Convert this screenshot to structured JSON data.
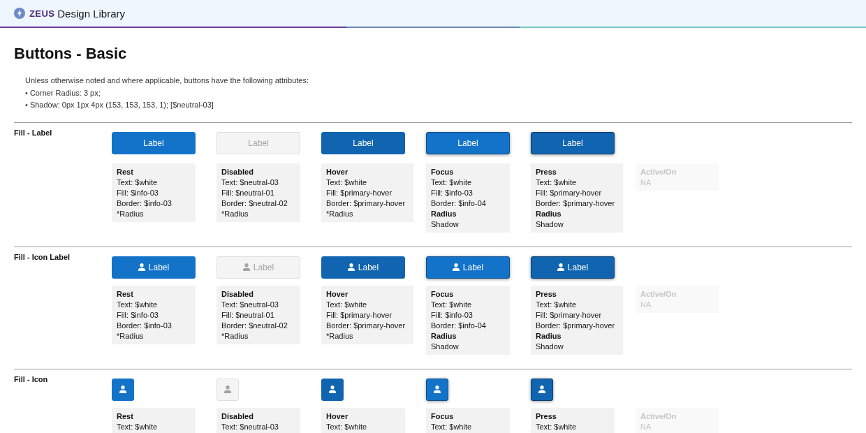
{
  "header": {
    "brand": "ZEUS",
    "title": "Design Library"
  },
  "page_title": "Buttons - Basic",
  "intro": {
    "text": "Unless otherwise noted and where applicable, buttons have the following attributes:",
    "bullets": [
      "• Corner Radius: 3 px;",
      "• Shadow: 0px 1px 4px (153, 153, 153, 1); [$neutral-03]"
    ]
  },
  "sections": [
    {
      "title": "Fill - Label",
      "kind": "label",
      "states": [
        {
          "kind": "rest",
          "button_label": "Label",
          "spec": {
            "title": "Rest",
            "lines": [
              {
                "text": "Text: $white",
                "bold": false
              },
              {
                "text": "Fill: $info-03",
                "bold": false
              },
              {
                "text": "Border: $info-03",
                "bold": false
              },
              {
                "text": "*Radius",
                "bold": false
              }
            ]
          }
        },
        {
          "kind": "disabled",
          "button_label": "Label",
          "spec": {
            "title": "Disabled",
            "lines": [
              {
                "text": "Text: $neutral-03",
                "bold": false
              },
              {
                "text": "Fill: $neutral-01",
                "bold": false
              },
              {
                "text": "Border: $neutral-02",
                "bold": false
              },
              {
                "text": "*Radius",
                "bold": false
              }
            ]
          }
        },
        {
          "kind": "hover",
          "button_label": "Label",
          "spec": {
            "title": "Hover",
            "lines": [
              {
                "text": "Text: $white",
                "bold": false
              },
              {
                "text": "Fill: $primary-hover",
                "bold": false
              },
              {
                "text": "Border: $primary-hover",
                "bold": false
              },
              {
                "text": "*Radius",
                "bold": false
              }
            ]
          }
        },
        {
          "kind": "focus",
          "button_label": "Label",
          "spec": {
            "title": "Focus",
            "lines": [
              {
                "text": "Text: $white",
                "bold": false
              },
              {
                "text": "Fill: $info-03",
                "bold": false
              },
              {
                "text": "Border: $info-04",
                "bold": false
              },
              {
                "text": "Radius",
                "bold": true
              },
              {
                "text": "Shadow",
                "bold": false
              }
            ]
          }
        },
        {
          "kind": "press",
          "button_label": "Label",
          "spec": {
            "title": "Press",
            "lines": [
              {
                "text": "Text: $white",
                "bold": false
              },
              {
                "text": "Fill: $primary-hover",
                "bold": false
              },
              {
                "text": "Border: $primary-hover",
                "bold": false
              },
              {
                "text": "Radius",
                "bold": true
              },
              {
                "text": "Shadow",
                "bold": false
              }
            ]
          }
        },
        {
          "kind": "na",
          "spec": {
            "title": "Active/On",
            "lines": [
              {
                "text": "NA",
                "bold": false
              }
            ]
          }
        }
      ]
    },
    {
      "title": "Fill - Icon Label",
      "kind": "icon-label",
      "states": [
        {
          "kind": "rest",
          "button_label": "Label",
          "spec": {
            "title": "Rest",
            "lines": [
              {
                "text": "Text: $white",
                "bold": false
              },
              {
                "text": "Fill: $info-03",
                "bold": false
              },
              {
                "text": "Border: $info-03",
                "bold": false
              },
              {
                "text": "*Radius",
                "bold": false
              }
            ]
          }
        },
        {
          "kind": "disabled",
          "button_label": "Label",
          "spec": {
            "title": "Disabled",
            "lines": [
              {
                "text": "Text: $neutral-03",
                "bold": false
              },
              {
                "text": "Fill: $neutral-01",
                "bold": false
              },
              {
                "text": "Border: $neutral-02",
                "bold": false
              },
              {
                "text": "*Radius",
                "bold": false
              }
            ]
          }
        },
        {
          "kind": "hover",
          "button_label": "Label",
          "spec": {
            "title": "Hover",
            "lines": [
              {
                "text": "Text: $white",
                "bold": false
              },
              {
                "text": "Fill: $primary-hover",
                "bold": false
              },
              {
                "text": "Border: $primary-hover",
                "bold": false
              },
              {
                "text": "*Radius",
                "bold": false
              }
            ]
          }
        },
        {
          "kind": "focus",
          "button_label": "Label",
          "spec": {
            "title": "Focus",
            "lines": [
              {
                "text": "Text: $white",
                "bold": false
              },
              {
                "text": "Fill: $info-03",
                "bold": false
              },
              {
                "text": "Border: $info-04",
                "bold": false
              },
              {
                "text": "Radius",
                "bold": true
              },
              {
                "text": "Shadow",
                "bold": false
              }
            ]
          }
        },
        {
          "kind": "press",
          "button_label": "Label",
          "spec": {
            "title": "Press",
            "lines": [
              {
                "text": "Text: $white",
                "bold": false
              },
              {
                "text": "Fill: $primary-hover",
                "bold": false
              },
              {
                "text": "Border: $primary-hover",
                "bold": false
              },
              {
                "text": "Radius",
                "bold": true
              },
              {
                "text": "Shadow",
                "bold": false
              }
            ]
          }
        },
        {
          "kind": "na",
          "spec": {
            "title": "Active/On",
            "lines": [
              {
                "text": "NA",
                "bold": false
              }
            ]
          }
        }
      ]
    },
    {
      "title": "Fill - Icon",
      "kind": "icon",
      "states": [
        {
          "kind": "rest",
          "spec": {
            "title": "Rest",
            "lines": [
              {
                "text": "Text: $white",
                "bold": false
              }
            ]
          }
        },
        {
          "kind": "disabled",
          "spec": {
            "title": "Disabled",
            "lines": [
              {
                "text": "Text: $neutral-03",
                "bold": false
              }
            ]
          }
        },
        {
          "kind": "hover",
          "spec": {
            "title": "Hover",
            "lines": [
              {
                "text": "Text: $white",
                "bold": false
              }
            ]
          }
        },
        {
          "kind": "focus",
          "spec": {
            "title": "Focus",
            "lines": [
              {
                "text": "Text: $white",
                "bold": false
              }
            ]
          }
        },
        {
          "kind": "press",
          "spec": {
            "title": "Press",
            "lines": [
              {
                "text": "Text: $white",
                "bold": false
              }
            ]
          }
        },
        {
          "kind": "na",
          "spec": {
            "title": "Active/On",
            "lines": [
              {
                "text": "NA",
                "bold": false
              }
            ]
          }
        }
      ]
    }
  ]
}
